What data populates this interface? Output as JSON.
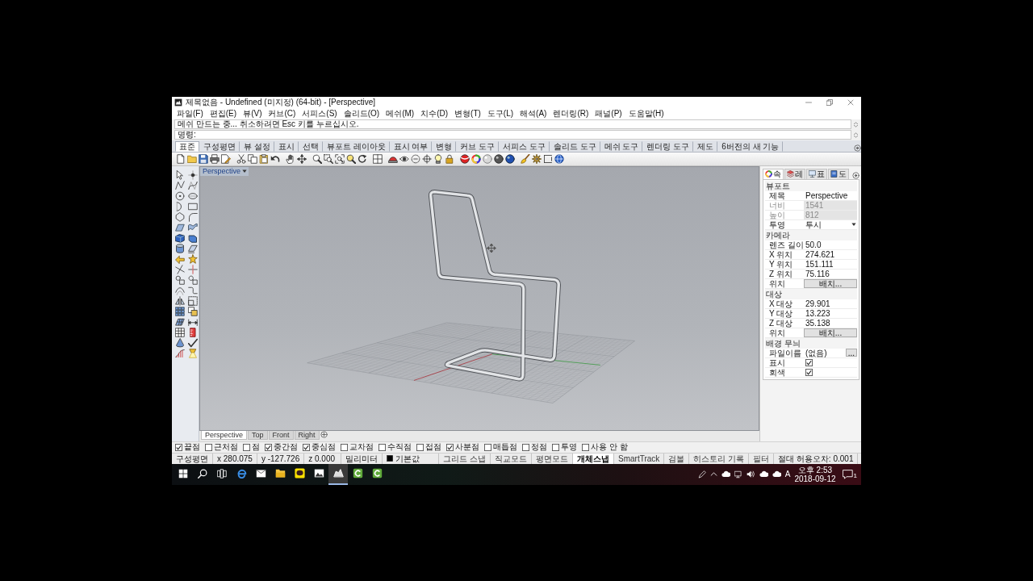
{
  "window": {
    "title": "제목없음 - Undefined (미지정) (64-bit) - [Perspective]"
  },
  "menu": [
    "파일(F)",
    "편집(E)",
    "뷰(V)",
    "커브(C)",
    "서피스(S)",
    "솔리드(O)",
    "메쉬(M)",
    "치수(D)",
    "변형(T)",
    "도구(L)",
    "해석(A)",
    "렌더링(R)",
    "패널(P)",
    "도움말(H)"
  ],
  "command": {
    "history": "메쉬 만드는 중... 취소하려면 Esc 키를 누르십시오.",
    "prompt": "명령:"
  },
  "toolbar_tabs": [
    {
      "label": "표준",
      "selected": true
    },
    {
      "label": "구성평면",
      "selected": false
    },
    {
      "label": "뷰 설정",
      "selected": false
    },
    {
      "label": "표시",
      "selected": false
    },
    {
      "label": "선택",
      "selected": false
    },
    {
      "label": "뷰포트 레이아웃",
      "selected": false
    },
    {
      "label": "표시 여부",
      "selected": false
    },
    {
      "label": "변형",
      "selected": false
    },
    {
      "label": "커브 도구",
      "selected": false
    },
    {
      "label": "서피스 도구",
      "selected": false
    },
    {
      "label": "솔리드 도구",
      "selected": false
    },
    {
      "label": "메쉬 도구",
      "selected": false
    },
    {
      "label": "렌더링 도구",
      "selected": false
    },
    {
      "label": "제도",
      "selected": false
    },
    {
      "label": "6버전의 새 기능",
      "selected": false
    }
  ],
  "viewport": {
    "title": "Perspective"
  },
  "viewport_tabs": [
    {
      "label": "Perspective",
      "selected": true
    },
    {
      "label": "Top",
      "selected": false
    },
    {
      "label": "Front",
      "selected": false
    },
    {
      "label": "Right",
      "selected": false
    }
  ],
  "properties_panel": {
    "tabs": [
      {
        "label": "속",
        "selected": true
      },
      {
        "label": "레",
        "selected": false
      },
      {
        "label": "표",
        "selected": false
      },
      {
        "label": "도",
        "selected": false
      }
    ],
    "sections": [
      {
        "title": "뷰포트",
        "rows": [
          {
            "kind": "text",
            "label": "제목",
            "value": "Perspective",
            "disabled": false
          },
          {
            "kind": "text",
            "label": "너비",
            "value": "1541",
            "disabled": true
          },
          {
            "kind": "text",
            "label": "높이",
            "value": "812",
            "disabled": true
          },
          {
            "kind": "dropdown",
            "label": "투영",
            "value": "투시",
            "disabled": false
          }
        ]
      },
      {
        "title": "카메라",
        "rows": [
          {
            "kind": "text",
            "label": "렌즈 길이",
            "value": "50.0",
            "disabled": false
          },
          {
            "kind": "text",
            "label": "X 위치",
            "value": "274.621",
            "disabled": false
          },
          {
            "kind": "text",
            "label": "Y 위치",
            "value": "151.111",
            "disabled": false
          },
          {
            "kind": "text",
            "label": "Z 위치",
            "value": "75.116",
            "disabled": false
          },
          {
            "kind": "button",
            "label": "위치",
            "value": "배치...",
            "disabled": false
          }
        ]
      },
      {
        "title": "대상",
        "rows": [
          {
            "kind": "text",
            "label": "X 대상",
            "value": "29.901",
            "disabled": false
          },
          {
            "kind": "text",
            "label": "Y 대상",
            "value": "13.223",
            "disabled": false
          },
          {
            "kind": "text",
            "label": "Z 대상",
            "value": "35.138",
            "disabled": false
          },
          {
            "kind": "button",
            "label": "위치",
            "value": "배치...",
            "disabled": false
          }
        ]
      },
      {
        "title": "배경 무늬",
        "rows": [
          {
            "kind": "file",
            "label": "파일이름",
            "value": "(없음)",
            "button": "...",
            "disabled": false
          },
          {
            "kind": "checkbox",
            "label": "표시",
            "checked": true,
            "disabled": false
          },
          {
            "kind": "checkbox",
            "label": "회색",
            "checked": true,
            "disabled": false
          }
        ]
      }
    ]
  },
  "osnaps": [
    {
      "label": "끝점",
      "checked": true
    },
    {
      "label": "근처점",
      "checked": false
    },
    {
      "label": "점",
      "checked": false
    },
    {
      "label": "중간점",
      "checked": true
    },
    {
      "label": "중심점",
      "checked": true
    },
    {
      "label": "교차점",
      "checked": false
    },
    {
      "label": "수직점",
      "checked": false
    },
    {
      "label": "접점",
      "checked": false
    },
    {
      "label": "사분점",
      "checked": true
    },
    {
      "label": "매듭점",
      "checked": false
    },
    {
      "label": "정점",
      "checked": false
    },
    {
      "label": "투영",
      "checked": false
    },
    {
      "label": "사용 안 함",
      "checked": false
    }
  ],
  "status_bar": {
    "cplane": "구성평면",
    "x": "x 280.075",
    "y": "y -127.726",
    "z": "z 0.000",
    "units": "밀리미터",
    "layer": "기본값",
    "toggles": [
      {
        "label": "그리드 스냅",
        "on": false
      },
      {
        "label": "직교모드",
        "on": false
      },
      {
        "label": "평면모드",
        "on": false
      },
      {
        "label": "개체스냅",
        "on": true
      },
      {
        "label": "SmartTrack",
        "on": false
      },
      {
        "label": "검볼",
        "on": false
      },
      {
        "label": "히스토리 기록",
        "on": false
      },
      {
        "label": "필터",
        "on": false
      }
    ],
    "tolerance": "절대 허용오차: 0.001"
  },
  "taskbar": {
    "apps": [
      {
        "selected": false
      },
      {
        "selected": false
      },
      {
        "selected": false
      },
      {
        "selected": false
      },
      {
        "selected": false
      },
      {
        "selected": true
      },
      {
        "selected": false
      },
      {
        "selected": false
      }
    ],
    "input_indicator": "A",
    "time": "오후 2:53",
    "date": "2018-09-12",
    "notification_count": "1"
  }
}
